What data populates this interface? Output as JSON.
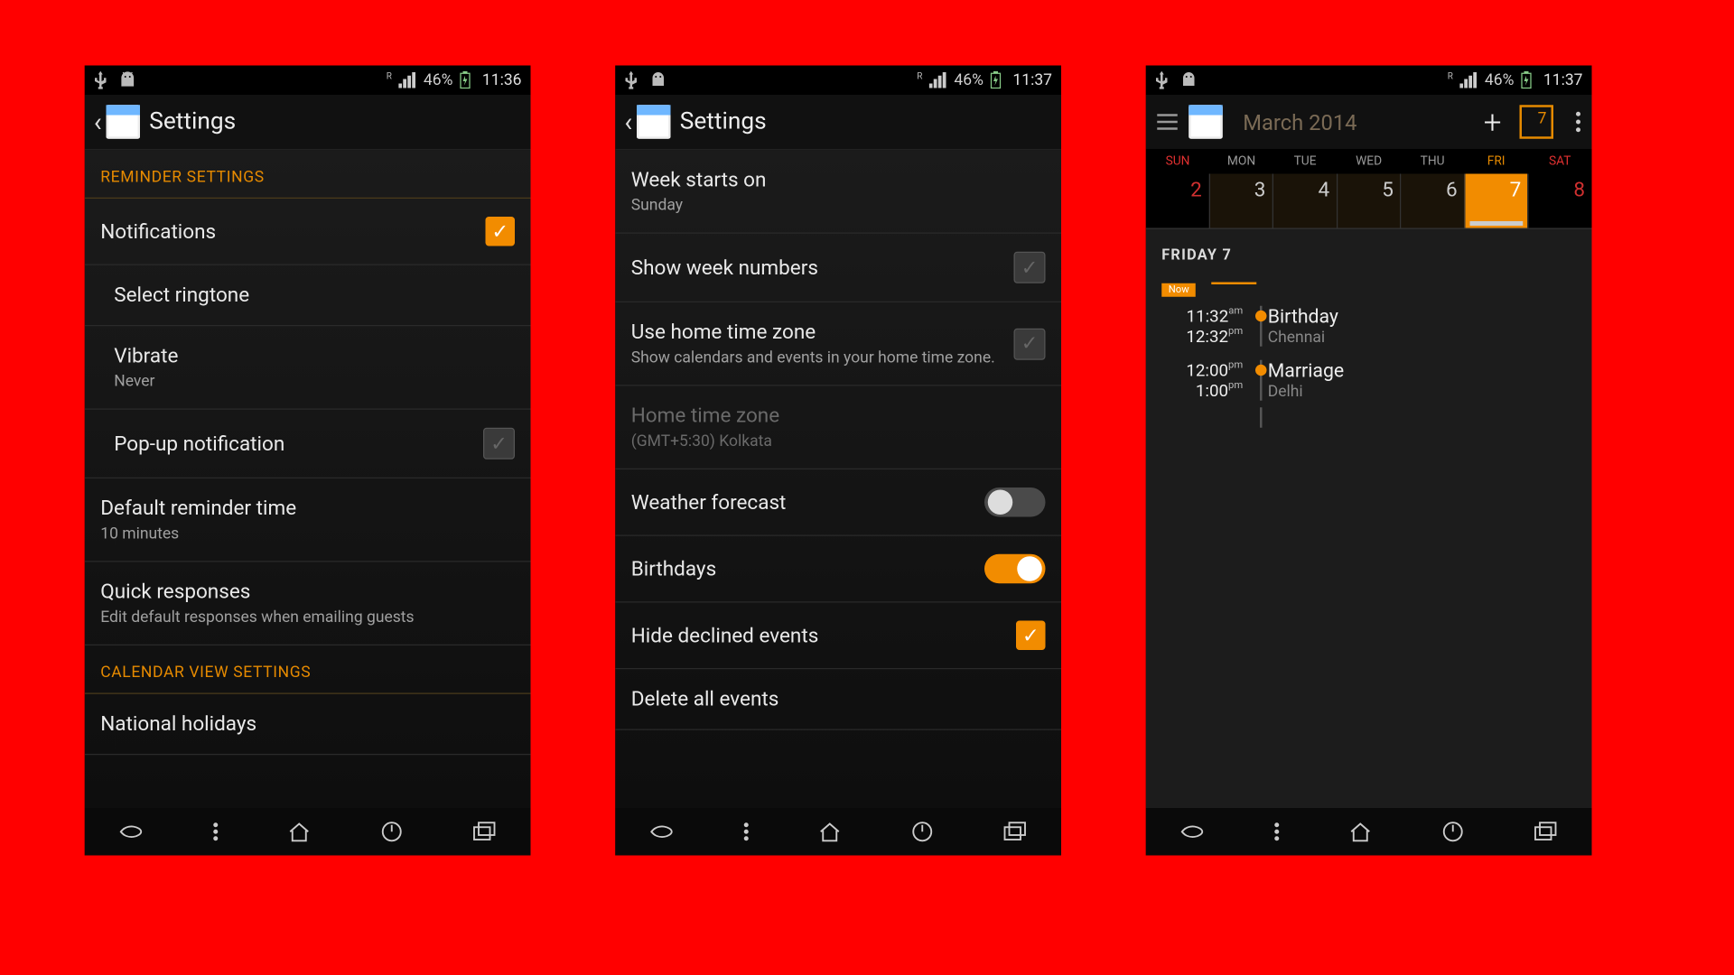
{
  "status": [
    {
      "battery": "46%",
      "clock": "11:36"
    },
    {
      "battery": "46%",
      "clock": "11:37"
    },
    {
      "battery": "46%",
      "clock": "11:37"
    }
  ],
  "screen1": {
    "title": "Settings",
    "section1": "REMINDER SETTINGS",
    "notifications": "Notifications",
    "select_ringtone": "Select ringtone",
    "vibrate": "Vibrate",
    "vibrate_sub": "Never",
    "popup": "Pop-up notification",
    "default_reminder": "Default reminder time",
    "default_reminder_sub": "10 minutes",
    "quick_responses": "Quick responses",
    "quick_responses_sub": "Edit default responses when emailing guests",
    "section2": "CALENDAR VIEW SETTINGS",
    "national_holidays": "National holidays"
  },
  "screen2": {
    "title": "Settings",
    "week_starts": "Week starts on",
    "week_starts_sub": "Sunday",
    "show_week_numbers": "Show week numbers",
    "use_home_tz": "Use home time zone",
    "use_home_tz_sub": "Show calendars and events in your home time zone.",
    "home_tz": "Home time zone",
    "home_tz_sub": "(GMT+5:30) Kolkata",
    "weather": "Weather forecast",
    "birthdays": "Birthdays",
    "hide_declined": "Hide declined events",
    "delete_all": "Delete all events"
  },
  "screen3": {
    "month_title": "March 2014",
    "today_num": "7",
    "dow": {
      "sun": "SUN",
      "mon": "MON",
      "tue": "TUE",
      "wed": "WED",
      "thu": "THU",
      "fri": "FRI",
      "sat": "SAT"
    },
    "dates": {
      "sun": "2",
      "mon": "3",
      "tue": "4",
      "wed": "5",
      "thu": "6",
      "fri": "7",
      "sat": "8"
    },
    "day_heading": "FRIDAY 7",
    "now_label": "Now",
    "events": [
      {
        "t1": "11:32",
        "ampm1": "am",
        "t2": "12:32",
        "ampm2": "pm",
        "title": "Birthday",
        "loc": "Chennai"
      },
      {
        "t1": "12:00",
        "ampm1": "pm",
        "t2": "1:00",
        "ampm2": "pm",
        "title": "Marriage",
        "loc": "Delhi"
      }
    ]
  }
}
